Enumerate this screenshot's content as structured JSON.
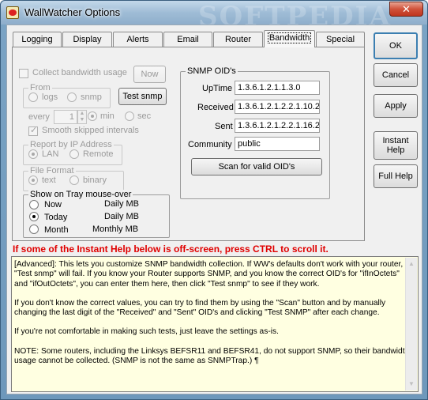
{
  "window": {
    "title": "WallWatcher Options",
    "close_glyph": "✕"
  },
  "watermark": "SOFTPEDIA",
  "tabs": [
    {
      "label": "Logging"
    },
    {
      "label": "Display"
    },
    {
      "label": "Alerts"
    },
    {
      "label": "Email"
    },
    {
      "label": "Router"
    },
    {
      "label": "Bandwidth",
      "active": true
    },
    {
      "label": "Special"
    }
  ],
  "side_buttons": {
    "ok": "OK",
    "cancel": "Cancel",
    "apply": "Apply",
    "instant_help_line1": "Instant",
    "instant_help_line2": "Help",
    "full_help": "Full Help"
  },
  "bandwidth": {
    "collect_label": "Collect bandwidth usage",
    "now_button": "Now",
    "from_group": "From",
    "from_logs": "logs",
    "from_snmp": "snmp",
    "test_snmp_button": "Test snmp",
    "every_label": "every",
    "every_value": "1",
    "every_min": "min",
    "every_sec": "sec",
    "smooth_label": "Smooth skipped intervals",
    "report_group": "Report by IP Address",
    "report_lan": "LAN",
    "report_remote": "Remote",
    "format_group": "File Format",
    "format_text": "text",
    "format_binary": "binary",
    "tray_group": "Show on Tray mouse-over",
    "tray_options": [
      {
        "label": "Now",
        "value": "Daily MB"
      },
      {
        "label": "Today",
        "value": "Daily MB",
        "selected": true
      },
      {
        "label": "Month",
        "value": "Monthly MB"
      }
    ]
  },
  "snmp": {
    "group_title": "SNMP OID's",
    "uptime_label": "UpTime",
    "uptime_value": "1.3.6.1.2.1.1.3.0",
    "received_label": "Received",
    "received_value": "1.3.6.1.2.1.2.2.1.10.2",
    "sent_label": "Sent",
    "sent_value": "1.3.6.1.2.1.2.2.1.16.2",
    "community_label": "Community",
    "community_value": "public",
    "scan_button": "Scan for valid OID's"
  },
  "warning": "If some of the Instant Help below is off-screen, press CTRL to scroll it.",
  "help": {
    "p1": "[Advanced]: This lets you customize SNMP bandwidth collection. If WW's defaults don't work with your router, \"Test snmp\" will  fail. If you know your Router supports SNMP, and you know the correct OID's for \"ifInOctets\" and \"ifOutOctets\", you can enter them here, then click \"Test snmp\" to see if they work.",
    "p2": "If you don't know the correct values, you can try to find them by using the \"Scan\" button and by manually changing the last digit of the \"Received\" and \"Sent\" OID's and clicking \"Test SNMP\" after each change.",
    "p3": "If you're not comfortable in making such tests, just leave the settings as-is.",
    "p4": "NOTE: Some routers, including the Linksys BEFSR11 and BEFSR41, do not support SNMP, so their bandwidth usage cannot be collected. (SNMP is not the same as SNMPTrap.) ¶"
  }
}
